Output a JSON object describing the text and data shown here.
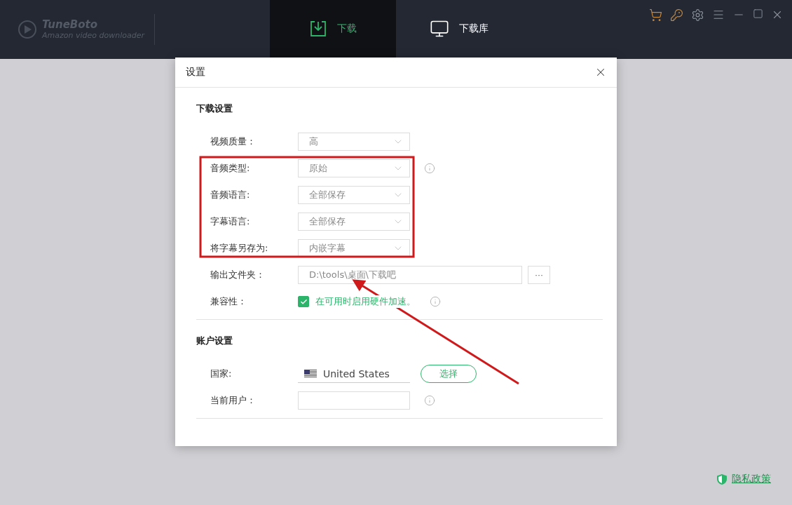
{
  "app": {
    "name": "TuneBoto",
    "subtitle": "Amazon video downloader"
  },
  "tabs": [
    {
      "label": "下载",
      "kind": "download",
      "selected": true
    },
    {
      "label": "下载库",
      "kind": "library",
      "selected": false
    }
  ],
  "dialog": {
    "title": "设置",
    "sections": [
      {
        "title": "下载设置",
        "rows": [
          {
            "kind": "select",
            "label": "视频质量：",
            "value": "高",
            "info": false
          },
          {
            "kind": "select",
            "label": "音频类型:",
            "value": "原始",
            "info": true
          },
          {
            "kind": "select",
            "label": "音频语言:",
            "value": "全部保存",
            "info": false
          },
          {
            "kind": "select",
            "label": "字幕语言:",
            "value": "全部保存",
            "info": false
          },
          {
            "kind": "select",
            "label": "将字幕另存为:",
            "value": "内嵌字幕",
            "info": false
          },
          {
            "kind": "path",
            "label": "输出文件夹：",
            "value": "D:\\tools\\桌面\\下载吧",
            "button": "···"
          },
          {
            "kind": "checkbox",
            "label": "兼容性：",
            "text": "在可用时启用硬件加速。",
            "checked": true,
            "info": true
          }
        ]
      },
      {
        "title": "账户设置",
        "rows": [
          {
            "kind": "country",
            "label": "国家:",
            "value": "United States",
            "button": "选择"
          },
          {
            "kind": "text",
            "label": "当前用户：",
            "value": "",
            "info": true
          }
        ]
      }
    ]
  },
  "privacy_link": "隐私政策"
}
